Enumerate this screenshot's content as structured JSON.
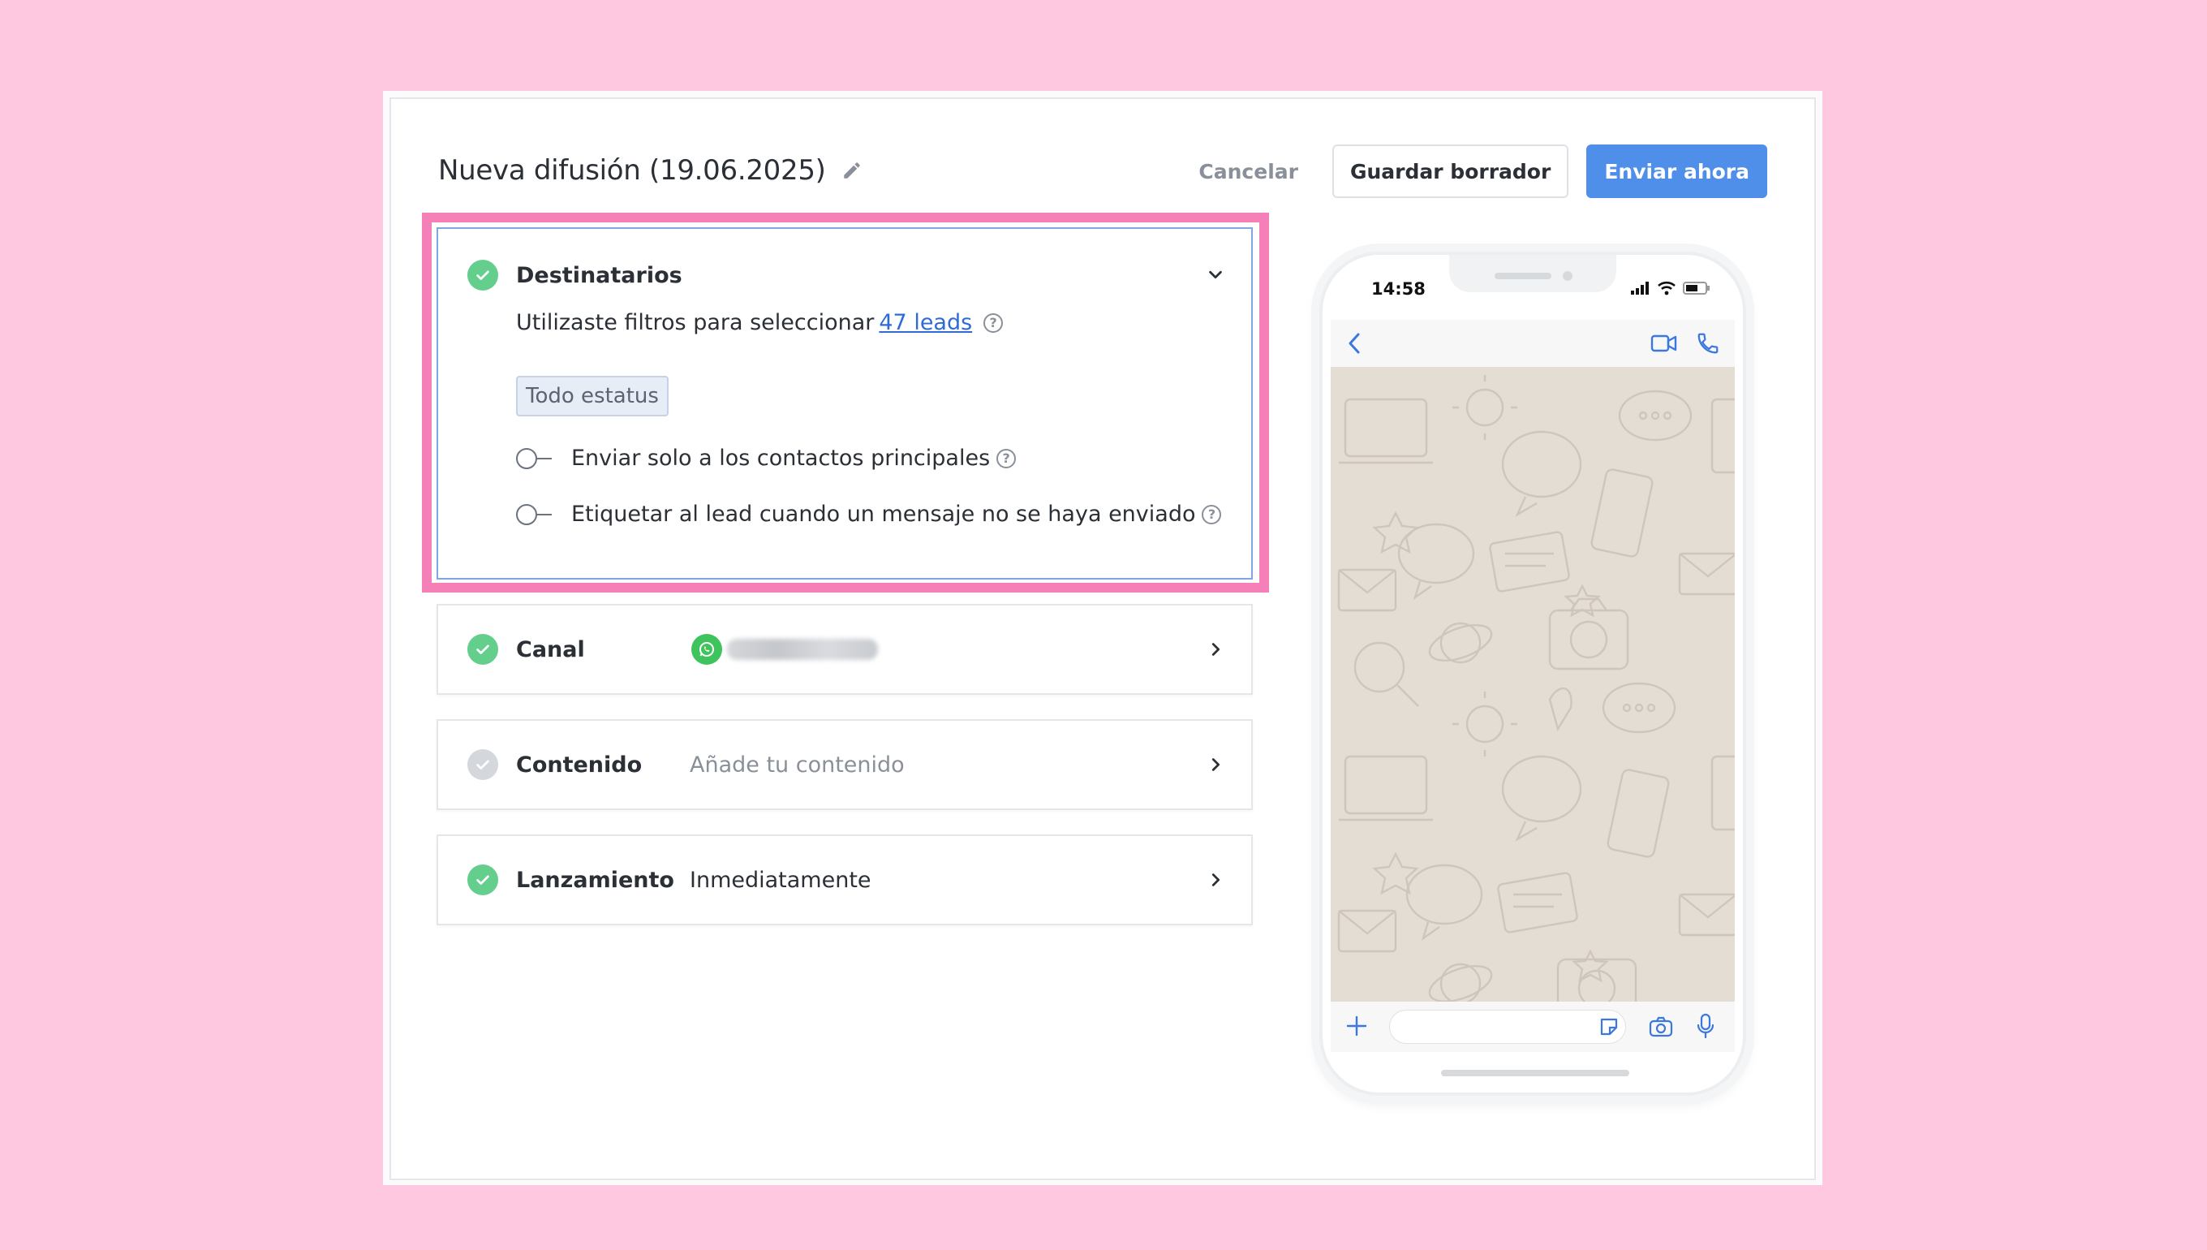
{
  "modal": {
    "title": "Nueva difusión (19.06.2025)",
    "actions": {
      "cancel": "Cancelar",
      "save_draft": "Guardar borrador",
      "send_now": "Enviar ahora"
    }
  },
  "recipients": {
    "label": "Destinatarios",
    "filter_text": "Utilizaste filtros para seleccionar",
    "leads_link": "47 leads",
    "status_tag": "Todo estatus",
    "toggle_main_contacts": "Enviar solo a los contactos principales",
    "toggle_tag_lead": "Etiquetar al lead cuando un mensaje no se haya enviado"
  },
  "channel": {
    "label": "Canal"
  },
  "content": {
    "label": "Contenido",
    "placeholder": "Añade tu contenido"
  },
  "launch": {
    "label": "Lanzamiento",
    "value": "Inmediatamente"
  },
  "phone_preview": {
    "time": "14:58"
  },
  "colors": {
    "accent": "#4f8fea",
    "success": "#64cf8c",
    "highlight": "#f57fb7",
    "background": "#ffc8e1",
    "whatsapp": "#3fc45d"
  }
}
